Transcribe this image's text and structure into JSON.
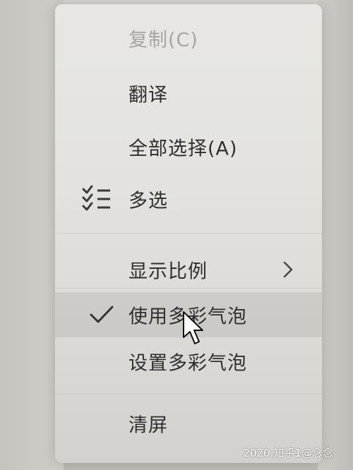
{
  "menu": {
    "copy_label": "复制(C)",
    "translate_label": "翻译",
    "select_all_label": "全部选择(A)",
    "multi_select_label": "多选",
    "display_scale_label": "显示比例",
    "use_colorful_bubbles_label": "使用多彩气泡",
    "set_colorful_bubbles_label": "设置多彩气泡",
    "clear_screen_label": "清屏"
  },
  "icons": {
    "multi_select": "multi-select-icon",
    "submenu": "chevron-right-icon",
    "checked": "checkmark-icon",
    "pointer": "mouse-pointer-icon"
  },
  "state": {
    "copy_enabled": false,
    "use_colorful_bubbles_checked": true
  },
  "watermark": "2020.知乎1@念念",
  "colors": {
    "menu_background": "#e5e4e0",
    "text": "#2f2f2f",
    "disabled_text": "#a6a5a2",
    "hover_highlight": "#d6d5d1"
  }
}
